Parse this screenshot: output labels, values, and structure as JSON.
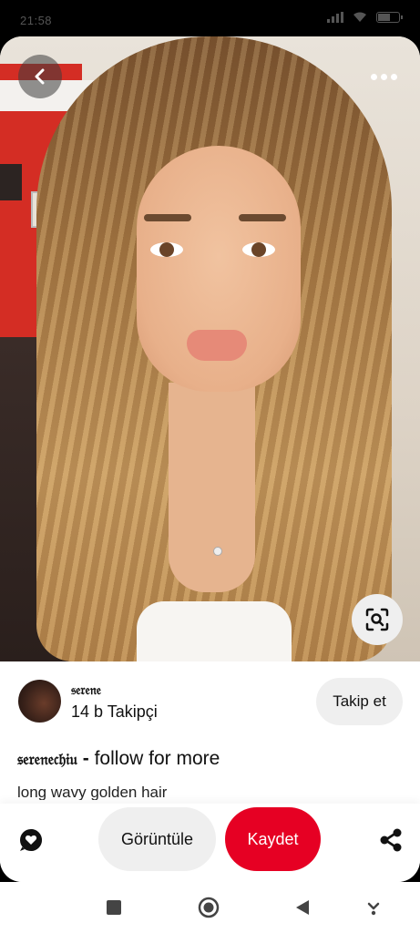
{
  "status_bar": {
    "time": "21:58"
  },
  "pin": {
    "creator": {
      "name": "𝔰𝔢𝔯𝔢𝔫𝔢",
      "followers": "14 b Takipçi",
      "follow_label": "Takip et"
    },
    "title_user": "𝔰𝔢𝔯𝔢𝔫𝔢𝔠𝔥𝔦𝔲",
    "title_sep": " - ",
    "title_text": "follow for more",
    "description": "long wavy golden hair"
  },
  "actions": {
    "view_label": "Görüntüle",
    "save_label": "Kaydet"
  },
  "colors": {
    "save_red": "#e60023",
    "button_grey": "#efefef"
  },
  "icons": {
    "back": "back-arrow-icon",
    "more": "more-dots-icon",
    "lens": "visual-search-icon",
    "react": "heart-bubble-icon",
    "share": "share-icon",
    "nav_recents": "square-icon",
    "nav_home": "circle-icon",
    "nav_back": "triangle-back-icon",
    "nav_down": "nav-down-icon"
  }
}
